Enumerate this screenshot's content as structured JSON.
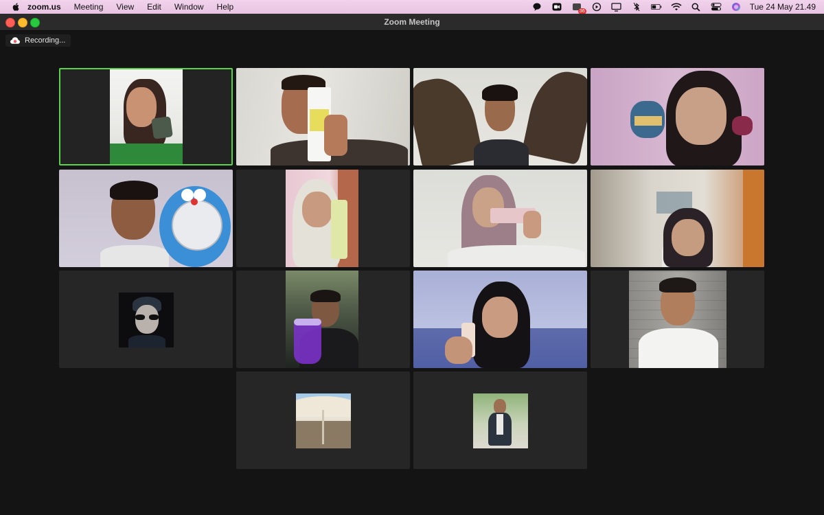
{
  "menubar": {
    "app": "zoom.us",
    "menus": [
      "Meeting",
      "View",
      "Edit",
      "Window",
      "Help"
    ],
    "notification_count": "36",
    "clock": "Tue 24 May  21.49"
  },
  "window": {
    "title": "Zoom Meeting"
  },
  "recording": {
    "label": "Recording..."
  },
  "colors": {
    "active_speaker_border": "#5bd44a",
    "tile_background": "#262626",
    "window_background": "#141414",
    "recording_icon": "#e8616a"
  }
}
